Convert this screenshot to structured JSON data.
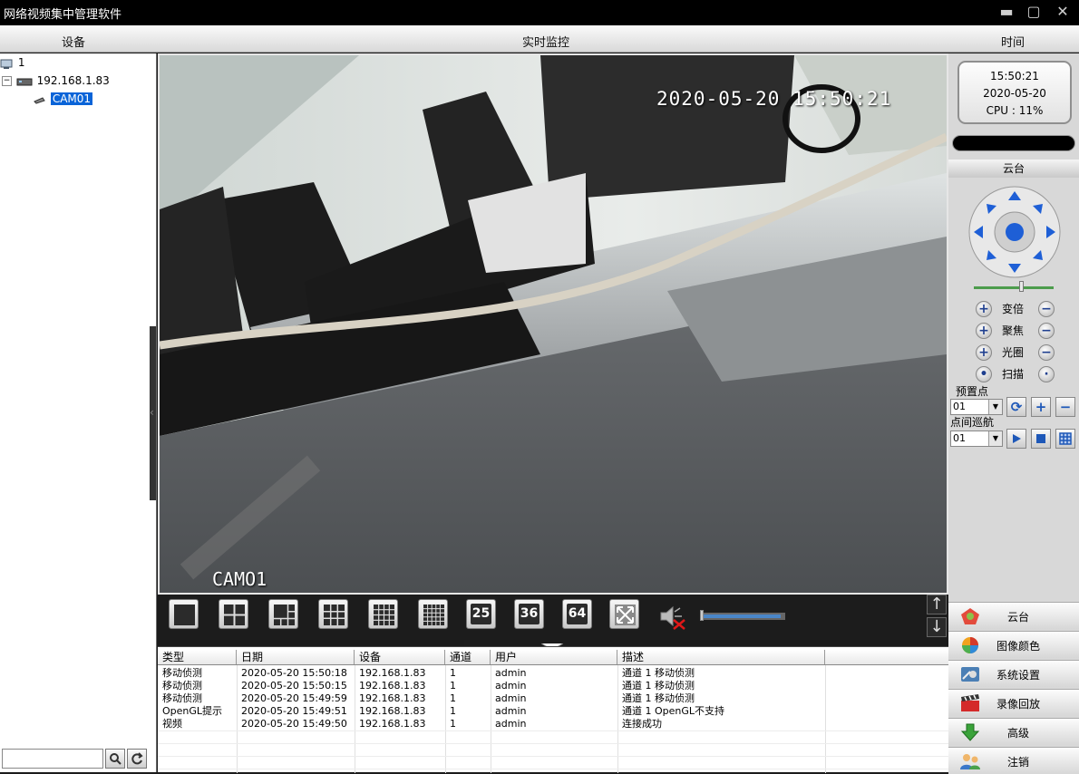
{
  "window": {
    "title": "网络视频集中管理软件"
  },
  "header": {
    "devices": "设备",
    "live_monitor": "实时监控",
    "time": "时间"
  },
  "device_tree": {
    "root": "1",
    "device": "192.168.1.83",
    "camera": "CAM01"
  },
  "video": {
    "osd_timestamp": "2020-05-20 15:50:21",
    "osd_camera_name": "CAMO1"
  },
  "toolbar": {
    "layouts": [
      "1",
      "4",
      "6",
      "9",
      "16",
      "16b"
    ],
    "number_buttons": [
      "25",
      "36",
      "64"
    ],
    "volume_level_pct": 95
  },
  "log": {
    "columns": [
      "类型",
      "日期",
      "设备",
      "通道",
      "用户",
      "描述"
    ],
    "rows": [
      [
        "移动侦测",
        "2020-05-20 15:50:18",
        "192.168.1.83",
        "1",
        "admin",
        "通道 1 移动侦测"
      ],
      [
        "移动侦测",
        "2020-05-20 15:50:15",
        "192.168.1.83",
        "1",
        "admin",
        "通道 1 移动侦测"
      ],
      [
        "移动侦测",
        "2020-05-20 15:49:59",
        "192.168.1.83",
        "1",
        "admin",
        "通道 1 移动侦测"
      ],
      [
        "OpenGL提示",
        "2020-05-20 15:49:51",
        "192.168.1.83",
        "1",
        "admin",
        "通道 1 OpenGL不支持"
      ],
      [
        "视频",
        "2020-05-20 15:49:50",
        "192.168.1.83",
        "1",
        "admin",
        "连接成功"
      ]
    ]
  },
  "clock": {
    "time": "15:50:21",
    "date": "2020-05-20",
    "cpu": "CPU : 11%"
  },
  "ptz": {
    "title": "云台",
    "zoom": "变倍",
    "focus": "聚焦",
    "iris": "光圈",
    "scan": "扫描",
    "preset_label": "预置点",
    "preset_value": "01",
    "cruise_label": "点间巡航",
    "cruise_value": "01",
    "speed_pct": 60
  },
  "menu": {
    "ptz": "云台",
    "image_color": "图像颜色",
    "system_settings": "系统设置",
    "playback": "录像回放",
    "advanced": "高级",
    "logout": "注销"
  },
  "colors": {
    "accent": "#1e5fd6",
    "selection": "#0a64d8"
  }
}
